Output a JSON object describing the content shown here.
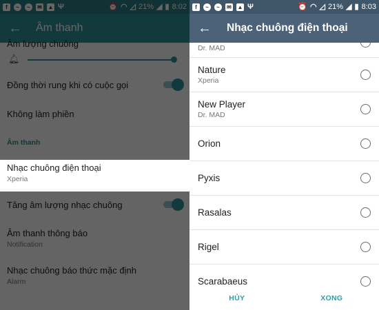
{
  "status_left": {
    "time": "8:02",
    "battery": "21%",
    "icons": [
      "facebook-icon",
      "messenger-icon",
      "messenger-icon",
      "mail-icon",
      "image-icon",
      "usb-icon"
    ]
  },
  "status_right": {
    "time": "8:03",
    "battery": "21%"
  },
  "left": {
    "title": "Âm thanh",
    "volume": {
      "label": "Âm lượng chuông",
      "level": 0.98
    },
    "rows": {
      "vibrate": {
        "label": "Đồng thời rung khi có cuộc gọi",
        "on": true
      },
      "dnd": {
        "label": "Không làm phiền"
      },
      "category": {
        "label": "Âm thanh"
      },
      "ringtone": {
        "label": "Nhạc chuông điện thoại",
        "value": "Xperia"
      },
      "increasing": {
        "label": "Tăng âm lượng nhạc chuông",
        "on": true
      },
      "notification": {
        "label": "Âm thanh thông báo",
        "value": "Notification"
      },
      "alarm": {
        "label": "Nhạc chuông báo thức mặc định",
        "value": "Alarm"
      }
    }
  },
  "right": {
    "title": "Nhạc chuông điện thoại",
    "items": [
      {
        "name": "",
        "sub": "Dr. MAD"
      },
      {
        "name": "Nature",
        "sub": "Xperia"
      },
      {
        "name": "New Player",
        "sub": "Dr. MAD"
      },
      {
        "name": "Orion",
        "sub": ""
      },
      {
        "name": "Pyxis",
        "sub": ""
      },
      {
        "name": "Rasalas",
        "sub": ""
      },
      {
        "name": "Rigel",
        "sub": ""
      },
      {
        "name": "Scarabaeus",
        "sub": ""
      }
    ],
    "cancel_label": "HỦY",
    "ok_label": "XONG"
  },
  "colors": {
    "teal": "#2e8f97",
    "slate": "#4b6279",
    "accent": "#2a9fb0"
  }
}
